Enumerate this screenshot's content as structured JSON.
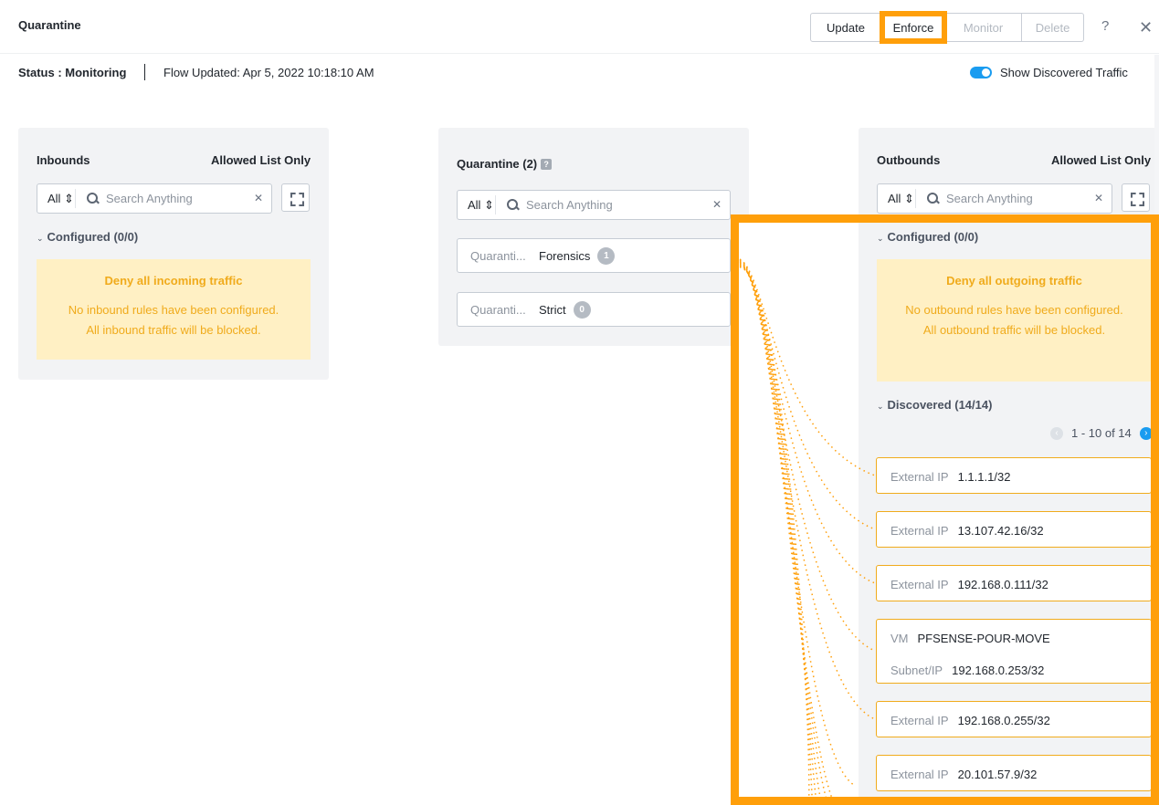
{
  "header": {
    "title": "Quarantine",
    "buttons": {
      "update": "Update",
      "enforce": "Enforce",
      "monitor": "Monitor",
      "delete": "Delete"
    },
    "help": "?",
    "close": "✕"
  },
  "status_bar": {
    "status": "Status : Monitoring",
    "flow_updated": "Flow Updated: Apr 5, 2022 10:18:10 AM",
    "toggle_label": "Show Discovered Traffic",
    "toggle_on": true
  },
  "inbounds": {
    "title": "Inbounds",
    "mode": "Allowed List Only",
    "filter": "All ⇕",
    "search_placeholder": "Search Anything",
    "configured": "Configured (0/0)",
    "warning_title": "Deny all incoming traffic",
    "warning_body": "No inbound rules have been configured. All inbound traffic will be blocked."
  },
  "quarantine": {
    "title": "Quarantine (2)",
    "help": "?",
    "filter": "All ⇕",
    "search_placeholder": "Search Anything",
    "items": [
      {
        "prefix": "Quaranti...",
        "name": "Forensics",
        "count": "1"
      },
      {
        "prefix": "Quaranti...",
        "name": "Strict",
        "count": "0"
      }
    ]
  },
  "outbounds": {
    "title": "Outbounds",
    "mode": "Allowed List Only",
    "filter": "All ⇕",
    "search_placeholder": "Search Anything",
    "configured": "Configured (0/0)",
    "warning_title": "Deny all outgoing traffic",
    "warning_body": "No outbound rules have been configured. All outbound traffic will be blocked.",
    "discovered": "Discovered (14/14)",
    "pager": "1 - 10 of 14",
    "items": [
      {
        "label": "External IP",
        "value": "1.1.1.1/32"
      },
      {
        "label": "External IP",
        "value": "13.107.42.16/32"
      },
      {
        "label": "External IP",
        "value": "192.168.0.111/32"
      },
      {
        "label": "VM",
        "value": "PFSENSE-POUR-MOVE",
        "label2": "Subnet/IP",
        "value2": "192.168.0.253/32"
      },
      {
        "label": "External IP",
        "value": "192.168.0.255/32"
      },
      {
        "label": "External IP",
        "value": "20.101.57.9/32"
      }
    ]
  },
  "colors": {
    "accent": "#ff9f0a",
    "toggle": "#1a9cf0",
    "warning_bg": "#fff0c4",
    "warning_text": "#f0ab1c"
  }
}
